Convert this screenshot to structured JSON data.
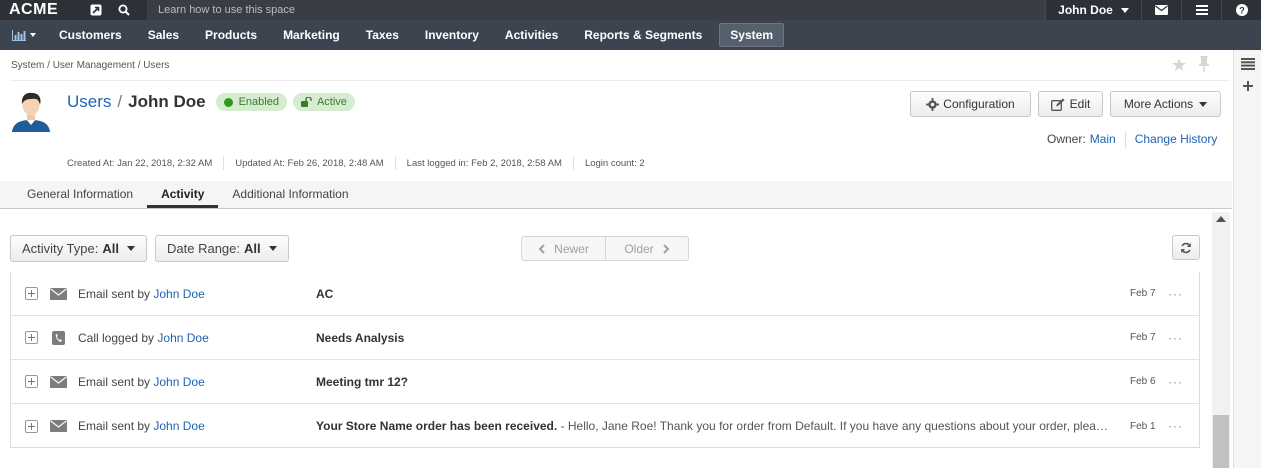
{
  "topbar": {
    "logo": "ACME",
    "search_placeholder": "Learn how to use this space",
    "user_name": "John Doe"
  },
  "nav": {
    "items": [
      {
        "label": "Customers"
      },
      {
        "label": "Sales"
      },
      {
        "label": "Products"
      },
      {
        "label": "Marketing"
      },
      {
        "label": "Taxes"
      },
      {
        "label": "Inventory"
      },
      {
        "label": "Activities"
      },
      {
        "label": "Reports & Segments"
      },
      {
        "label": "System"
      }
    ],
    "active": "System"
  },
  "breadcrumb": [
    "System",
    "User Management",
    "Users"
  ],
  "header": {
    "entity_link": "Users",
    "separator": "/",
    "name": "John Doe",
    "badges": [
      {
        "label": "Enabled"
      },
      {
        "label": "Active"
      }
    ],
    "buttons": {
      "configuration": "Configuration",
      "edit": "Edit",
      "more_actions": "More Actions"
    },
    "owner_label": "Owner:",
    "owner_value": "Main",
    "change_history": "Change History"
  },
  "meta": {
    "created": "Created At: Jan 22, 2018, 2:32 AM",
    "updated": "Updated At: Feb 26, 2018, 2:48 AM",
    "last_logged": "Last logged in: Feb 2, 2018, 2:58 AM",
    "login_count": "Login count: 2"
  },
  "tabs": [
    {
      "label": "General Information"
    },
    {
      "label": "Activity"
    },
    {
      "label": "Additional Information"
    }
  ],
  "active_tab": "Activity",
  "filters": {
    "activity_type_label": "Activity Type:",
    "activity_type_value": "All",
    "date_range_label": "Date Range:",
    "date_range_value": "All"
  },
  "pager": {
    "newer": "Newer",
    "older": "Older"
  },
  "activities": [
    {
      "icon": "envelope-icon",
      "action": "Email sent by",
      "user": "John Doe",
      "subject": "AC",
      "snippet": "",
      "date": "Feb 7"
    },
    {
      "icon": "phone-icon",
      "action": "Call logged by",
      "user": "John Doe",
      "subject": "Needs Analysis",
      "snippet": "",
      "date": "Feb 7"
    },
    {
      "icon": "envelope-icon",
      "action": "Email sent by",
      "user": "John Doe",
      "subject": "Meeting tmr 12?",
      "snippet": "",
      "date": "Feb 6"
    },
    {
      "icon": "envelope-icon",
      "action": "Email sent by",
      "user": "John Doe",
      "subject": "Your Store Name order has been received.",
      "snippet": " - Hello, Jane Roe! Thank you for order from Default. If you have any questions about your order, plea…",
      "date": "Feb 1"
    }
  ],
  "row_more": "···"
}
